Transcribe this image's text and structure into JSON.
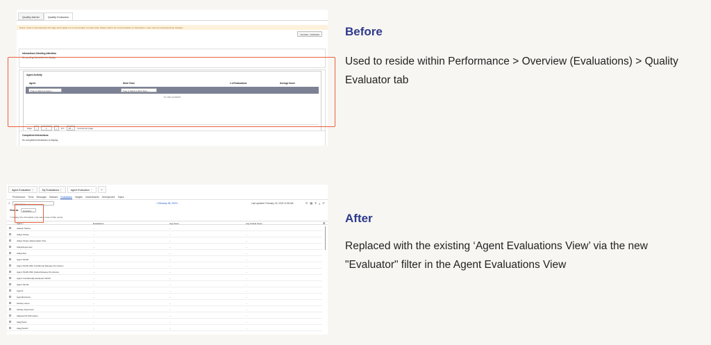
{
  "before": {
    "heading": "Before",
    "description": "Used to reside within Performance > Overview (Evaluations) > Quality Evaluator tab",
    "screenshot": {
      "tabs": [
        "Quality Admin",
        "Quality Evaluator"
      ],
      "warning": "Notice: Chart.io will deprecate this page and migrate it to a new location at a later date. Please switch. No communication on this feature. Learn more by exporting those changes.",
      "date_range": "2/1/2023 - 2/28/2023",
      "needing_attention_title": "Interactions Needing Attention",
      "needing_attention_text": "No pending interactions to display.",
      "agent_activity_title": "Agent Activity",
      "columns": [
        "Agent",
        "Work Team",
        "# of Evaluations",
        "Average Score"
      ],
      "agent_placeholder": "Type or Select an Agent",
      "workteam_placeholder": "Type or Select a Work Team",
      "no_data": "No data available",
      "pager": {
        "page_label": "Page",
        "page_value": "1",
        "of_label": "of 1",
        "per_page": "25",
        "per_page_label": "records per page"
      },
      "completed_title": "Completed Interactions",
      "completed_text": "No completed interactions to display."
    }
  },
  "after": {
    "heading": "After",
    "description": "Replaced with the existing ‘Agent Evaluations View’ via the new \"Evaluator\" filter in the Agent Evaluations View",
    "screenshot": {
      "tabs": [
        "Agent Evaluation",
        "My Evaluations",
        "Agent Evaluation",
        "+"
      ],
      "nav": [
        "Performance",
        "Trend",
        "Messages",
        "Statuses",
        "Evaluations",
        "Insights",
        "Leaderboards",
        "Development",
        "Topics"
      ],
      "active_nav": "Evaluations",
      "search_placeholder": "Filter Agent",
      "date": "February 28, 2023",
      "last_updated": "Last updated: February 23, 2023 11:58 AM",
      "view_label": "View as",
      "view_value": "Evaluator",
      "checkbox_label": "Display Non-Scoreable (only select rows to filter users)",
      "columns": [
        "Agent",
        "Evaluations",
        "Avg Score",
        "Avg Critical Score"
      ],
      "rows": [
        "Aakash Nellore",
        "Aditya Shetty",
        "Aditya Shetty Aditya Dawin Test",
        "AdityaSupervisor",
        "AdityaTest",
        "Agent ISO20",
        "Agent ISO20 With Conditional Release Permission",
        "Agent ISO20 With Global Release Permission",
        "Agent Conditionally Evaluator ISO20",
        "Agent Sanda",
        "Agent1",
        "AgentEnvtesta",
        "Akshay Home",
        "Akshay Supervisor",
        "Alagusamil Vellmurgan",
        "AlagyTest1",
        "AlagyTest10"
      ],
      "empty_cell": "--"
    }
  }
}
